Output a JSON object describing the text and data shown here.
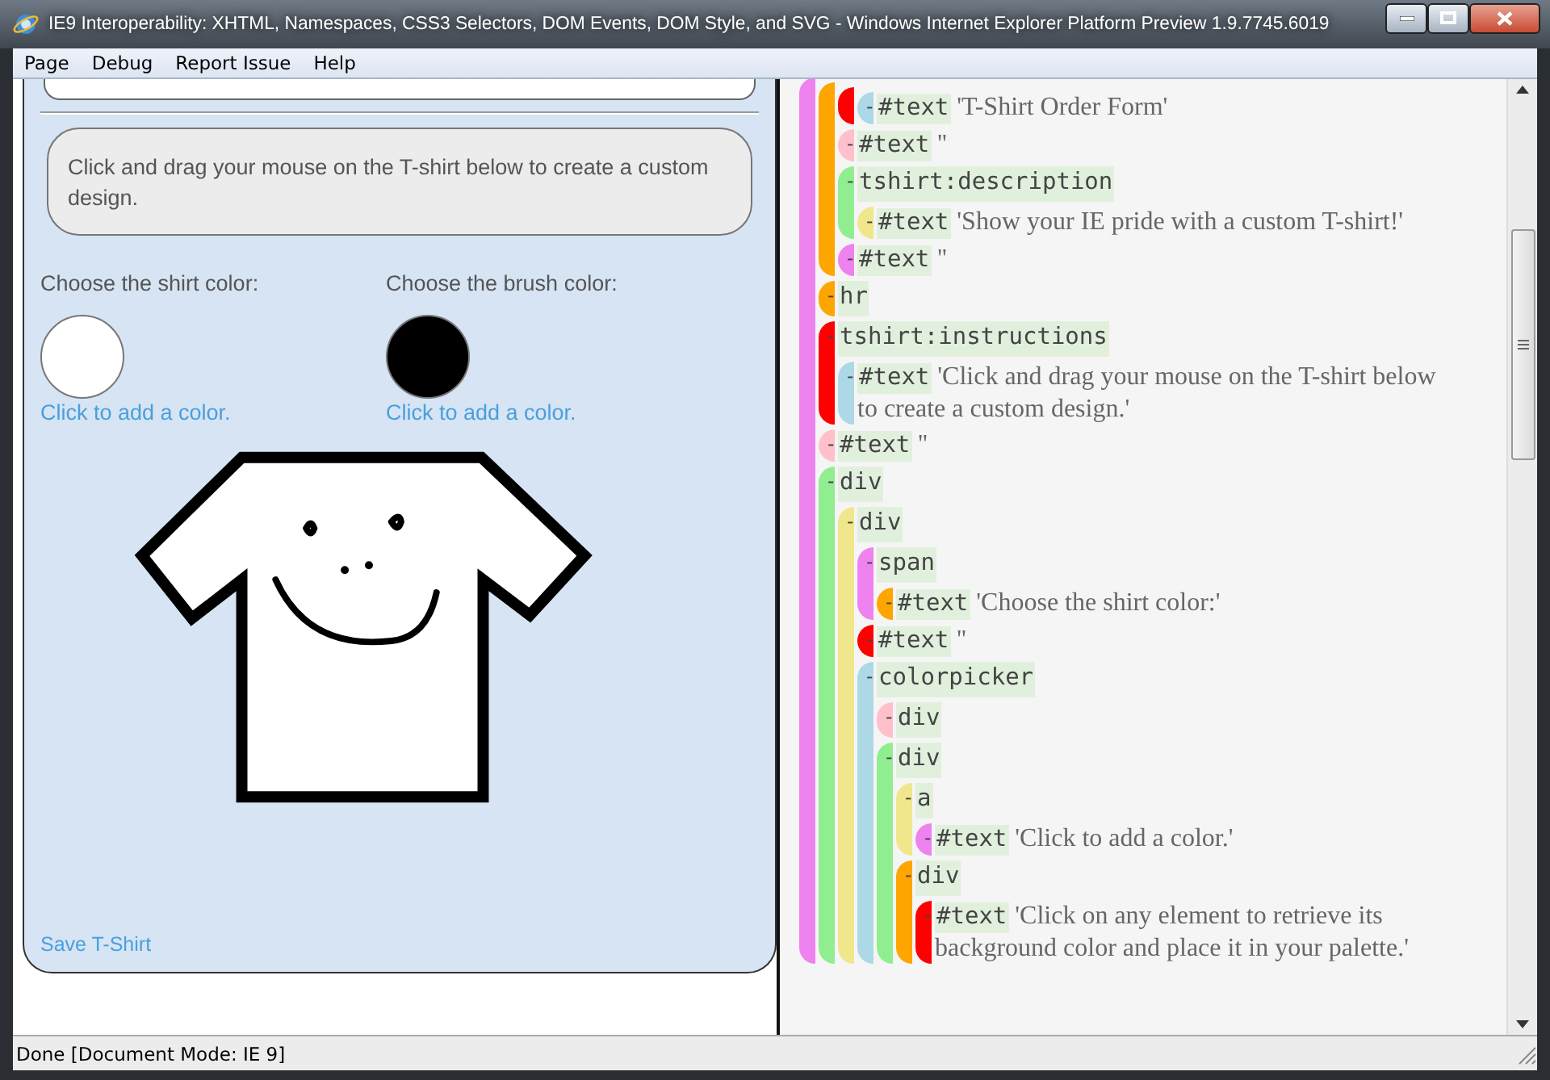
{
  "window": {
    "title": "IE9 Interoperability: XHTML, Namespaces, CSS3 Selectors, DOM Events, DOM Style, and SVG - Windows Internet Explorer Platform Preview 1.9.7745.6019"
  },
  "menu": [
    "Page",
    "Debug",
    "Report Issue",
    "Help"
  ],
  "page": {
    "instructions": "Click and drag your mouse on the T-shirt below to create a custom design.",
    "pickers": [
      {
        "label": "Choose the shirt color:",
        "color": "#ffffff",
        "link": "Click to add a color."
      },
      {
        "label": "Choose the brush color:",
        "color": "#000000",
        "link": "Click to add a color."
      }
    ],
    "save_link": "Save T-Shirt"
  },
  "dom_tree": [
    {
      "color": "#ee82ee",
      "children": [
        {
          "color": "#ffa500",
          "children": [
            {
              "color": "#ff0000",
              "children": [
                {
                  "color": "#add8e6",
                  "toggle": "-",
                  "name": "#text",
                  "value": "'T-Shirt Order Form'"
                }
              ]
            },
            {
              "color": "#ffc0cb",
              "toggle": "-",
              "name": "#text",
              "value": "''"
            },
            {
              "color": "#90ee90",
              "toggle": "-",
              "name": "tshirt:description",
              "children": [
                {
                  "color": "#f0e68c",
                  "toggle": "-",
                  "name": "#text",
                  "value": "'Show your IE pride with a custom T-shirt!'"
                }
              ]
            },
            {
              "color": "#ee82ee",
              "toggle": "-",
              "name": "#text",
              "value": "''"
            }
          ]
        },
        {
          "color": "#ffa500",
          "toggle": "-",
          "name": "hr"
        },
        {
          "color": "#ff0000",
          "toggle": "-",
          "name": "tshirt:instructions",
          "children": [
            {
              "color": "#add8e6",
              "toggle": "-",
              "name": "#text",
              "value": "'Click and drag your mouse on the T-shirt below to create a custom design.'"
            }
          ]
        },
        {
          "color": "#ffc0cb",
          "toggle": "-",
          "name": "#text",
          "value": "''"
        },
        {
          "color": "#90ee90",
          "toggle": "-",
          "name": "div",
          "children": [
            {
              "color": "#f0e68c",
              "toggle": "-",
              "name": "div",
              "children": [
                {
                  "color": "#ee82ee",
                  "toggle": "-",
                  "name": "span",
                  "children": [
                    {
                      "color": "#ffa500",
                      "toggle": "-",
                      "name": "#text",
                      "value": "'Choose the shirt color:'"
                    }
                  ]
                },
                {
                  "color": "#ff0000",
                  "toggle": "-",
                  "name": "#text",
                  "value": "''"
                },
                {
                  "color": "#add8e6",
                  "toggle": "-",
                  "name": "colorpicker",
                  "children": [
                    {
                      "color": "#ffc0cb",
                      "toggle": "-",
                      "name": "div"
                    },
                    {
                      "color": "#90ee90",
                      "toggle": "-",
                      "name": "div",
                      "children": [
                        {
                          "color": "#f0e68c",
                          "toggle": "-",
                          "name": "a",
                          "children": [
                            {
                              "color": "#ee82ee",
                              "toggle": "-",
                              "name": "#text",
                              "value": "'Click to add a color.'"
                            }
                          ]
                        },
                        {
                          "color": "#ffa500",
                          "toggle": "-",
                          "name": "div",
                          "children": [
                            {
                              "color": "#ff0000",
                              "toggle": "-",
                              "name": "#text",
                              "value": "'Click on any element to retrieve its background color and place it in your palette.'"
                            }
                          ]
                        }
                      ]
                    }
                  ]
                }
              ]
            }
          ]
        }
      ]
    }
  ],
  "status_bar": "Done [Document Mode: IE 9]"
}
